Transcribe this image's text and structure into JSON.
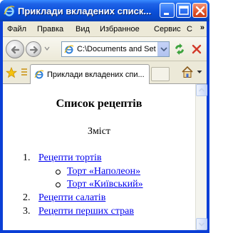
{
  "window": {
    "title": "Приклади вкладених списк...",
    "controls": [
      "minimize-icon",
      "maximize-icon",
      "close-icon"
    ]
  },
  "menu": {
    "items": [
      "Файл",
      "Правка",
      "Вид",
      "Избранное",
      "Сервис",
      "С"
    ],
    "overflow": "»"
  },
  "address_bar": {
    "value": "C:\\Documents and Set",
    "icons": [
      "back-icon",
      "forward-icon",
      "page-icon",
      "go-icon",
      "stop-icon"
    ]
  },
  "tabs": {
    "active_label": "Приклади вкладених спи...",
    "icons": [
      "favorites-star-icon",
      "add-favorite-icon",
      "home-icon"
    ]
  },
  "page": {
    "heading": "Список рецептів",
    "contents_label": "Зміст",
    "list": [
      {
        "number": "1.",
        "label": "Рецепти тортів",
        "children": [
          "Торт «Наполеон»",
          "Торт «Київський»"
        ]
      },
      {
        "number": "2.",
        "label": "Рецепти салатів"
      },
      {
        "number": "3.",
        "label": "Рецепти перших страв"
      }
    ]
  },
  "colors": {
    "titlebar": "#0a4fd8",
    "link": "#0000ee",
    "chrome": "#ece9d8"
  }
}
